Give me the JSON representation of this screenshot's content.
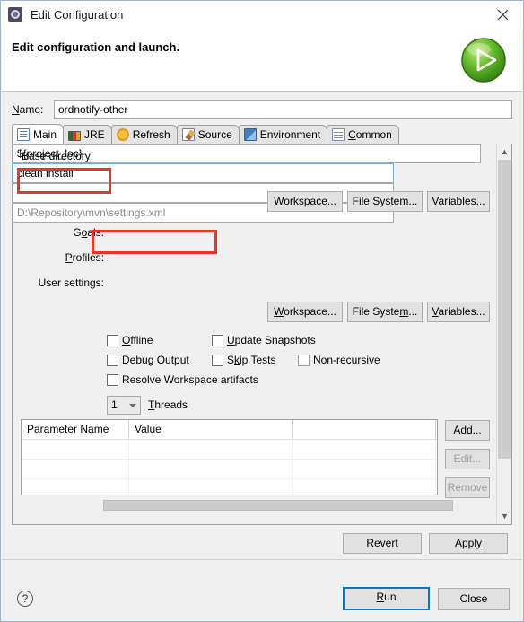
{
  "window": {
    "title": "Edit Configuration",
    "title_icon": "gear-square-icon",
    "close_icon": "close-icon"
  },
  "header": {
    "title": "Edit configuration and launch.",
    "badge_icon": "run-play-icon"
  },
  "name_field": {
    "label": "Name:",
    "value": "ordnotify-other"
  },
  "tabs": [
    {
      "label": "Main",
      "icon": "document-icon",
      "active": true
    },
    {
      "label": "JRE",
      "icon": "books-icon",
      "active": false
    },
    {
      "label": "Refresh",
      "icon": "refresh-arrows-icon",
      "active": false
    },
    {
      "label": "Source",
      "icon": "source-pencil-icon",
      "active": false
    },
    {
      "label": "Environment",
      "icon": "environment-globe-icon",
      "active": false
    },
    {
      "label": "Common",
      "icon": "common-table-icon",
      "active": false
    }
  ],
  "main_tab": {
    "base_directory": {
      "label": "Base directory:",
      "value": "${project_loc}"
    },
    "dir_buttons": [
      {
        "label": "Workspace..."
      },
      {
        "label": "File System..."
      },
      {
        "label": "Variables..."
      }
    ],
    "goals": {
      "label": "Goals:",
      "value": "clean install"
    },
    "profiles": {
      "label": "Profiles:",
      "value": ""
    },
    "user_settings": {
      "label": "User settings:",
      "value": "D:\\Repository\\mvn\\settings.xml"
    },
    "settings_buttons": [
      {
        "label": "Workspace..."
      },
      {
        "label": "File System..."
      },
      {
        "label": "Variables..."
      }
    ],
    "checkboxes": [
      {
        "label": "Offline",
        "checked": false
      },
      {
        "label": "Update Snapshots",
        "checked": false
      },
      {
        "label": "Debug Output",
        "checked": false
      },
      {
        "label": "Skip Tests",
        "checked": false
      },
      {
        "label": "Non-recursive",
        "checked": false
      },
      {
        "label": "Resolve Workspace artifacts",
        "checked": false
      }
    ],
    "threads": {
      "value": "1",
      "label": "Threads"
    },
    "parameter_table": {
      "columns": [
        "Parameter Name",
        "Value",
        ""
      ],
      "rows": [
        [
          "",
          "",
          ""
        ],
        [
          "",
          "",
          ""
        ],
        [
          "",
          "",
          ""
        ]
      ]
    },
    "table_buttons": [
      {
        "label": "Add...",
        "enabled": true
      },
      {
        "label": "Edit...",
        "enabled": false
      },
      {
        "label": "Remove",
        "enabled": false
      }
    ]
  },
  "footer": {
    "revert_label": "Revert",
    "apply_label": "Apply",
    "run_label": "Run",
    "close_label": "Close",
    "help_glyph": "?",
    "help_icon": "help-question-icon"
  },
  "annotations": {
    "accent_color": "#e8352a",
    "highlights": [
      "base-directory-value",
      "goals-field"
    ]
  }
}
